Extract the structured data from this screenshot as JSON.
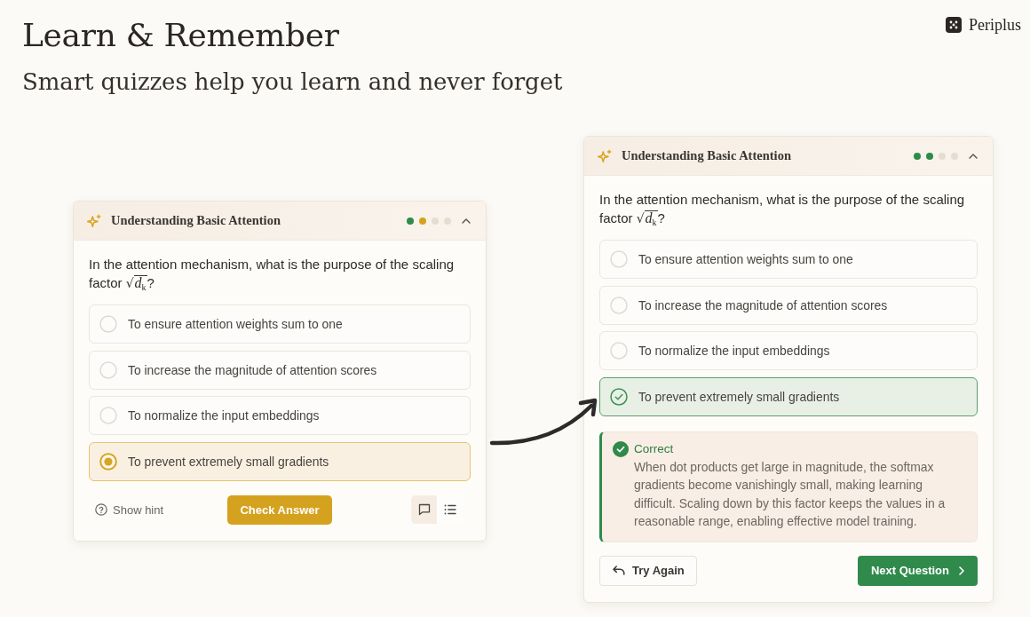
{
  "brand": {
    "name": "Periplus"
  },
  "hero": {
    "title": "Learn & Remember",
    "subtitle": "Smart quizzes help you learn and never forget"
  },
  "cards": [
    {
      "title": "Understanding Basic Attention",
      "expanded": true,
      "progress": [
        {
          "color": "#2e8b4a"
        },
        {
          "color": "#d4a21f"
        },
        {
          "color": "#e6ddd2"
        },
        {
          "color": "#e6ddd2"
        }
      ],
      "question": {
        "text": "In the attention mechanism, what is the purpose of the scaling factor",
        "radical": "√",
        "radicand": "*d*$_{k}$",
        "end": "?"
      },
      "checked": false,
      "options": [
        {
          "label": "To ensure attention weights sum to one",
          "selected": false
        },
        {
          "label": "To increase the magnitude of attention scores",
          "selected": false
        },
        {
          "label": "To normalize the input embeddings",
          "selected": false
        },
        {
          "label": "To prevent extremely small gradients",
          "selected": true
        }
      ],
      "actions": [
        {
          "kind": "hint",
          "label": "Show hint"
        },
        {
          "kind": "check",
          "label": "Check Answer"
        }
      ],
      "view_modes": [
        {
          "kind": "chat",
          "selected": true
        },
        {
          "kind": "list",
          "selected": false
        }
      ]
    },
    {
      "title": "Understanding Basic Attention",
      "expanded": true,
      "progress": [
        {
          "color": "#2e8b4a"
        },
        {
          "color": "#2e8b4a"
        },
        {
          "color": "#e6ddd2"
        },
        {
          "color": "#e6ddd2"
        }
      ],
      "question": {
        "text": "In the attention mechanism, what is the purpose of the scaling factor",
        "radical": "√",
        "radicand": "*d*$_{k}$",
        "end": "?"
      },
      "checked": true,
      "options": [
        {
          "label": "To ensure attention weights sum to one",
          "selected": false
        },
        {
          "label": "To increase the magnitude of attention scores",
          "selected": false
        },
        {
          "label": "To normalize the input embeddings",
          "selected": false
        },
        {
          "label": "To prevent extremely small gradients",
          "selected": true
        }
      ],
      "feedback": {
        "title": "Correct",
        "body": "When dot products get large in magnitude, the softmax gradients become vanishingly small, making learning difficult. Scaling down by this factor keeps the values in a reasonable range, enabling effective model training."
      },
      "actions": [
        {
          "kind": "retry",
          "label": "Try Again"
        },
        {
          "kind": "next",
          "label": "Next Question"
        }
      ]
    }
  ]
}
